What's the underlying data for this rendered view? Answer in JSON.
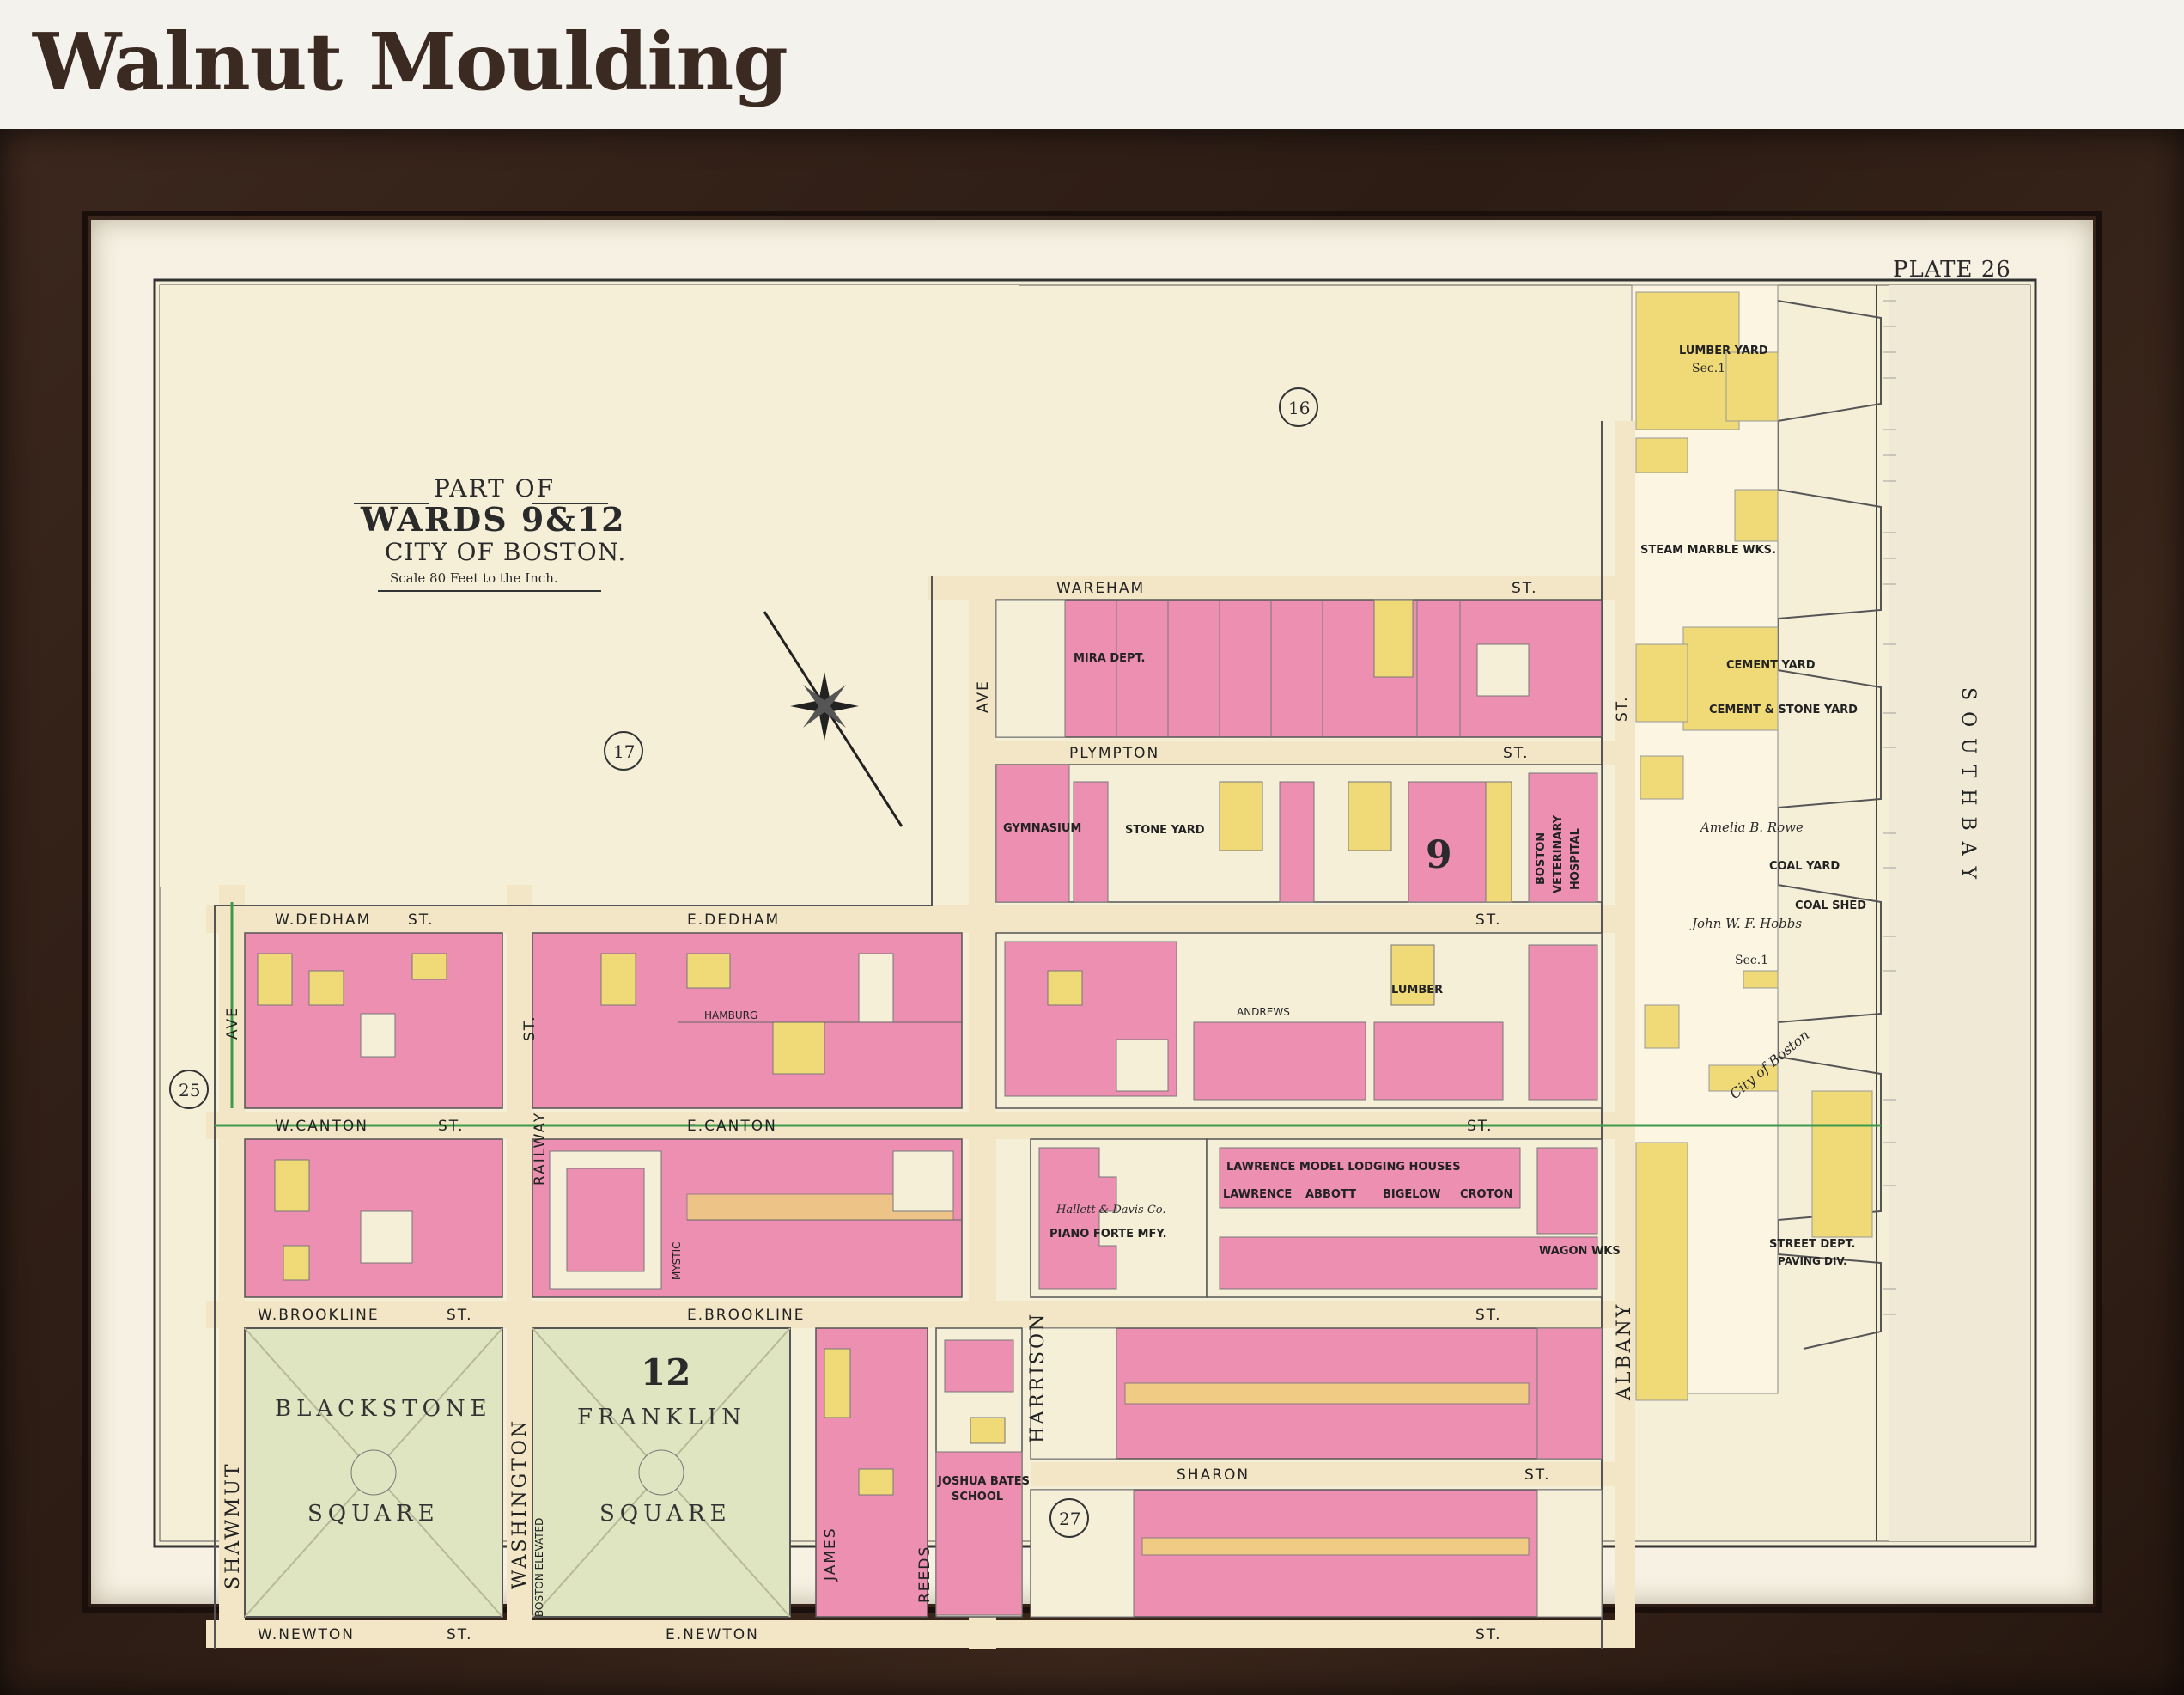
{
  "header": {
    "title": "Walnut Moulding"
  },
  "map": {
    "plate": "PLATE 26",
    "cartouche": {
      "line1": "PART OF",
      "line2": "WARDS 9&12",
      "line3": "CITY OF BOSTON.",
      "scale": "Scale 80 Feet to the Inch."
    },
    "ward_markers": [
      "16",
      "17",
      "25",
      "27"
    ],
    "streets": {
      "wareham": "WAREHAM",
      "plympton": "PLYMPTON",
      "w_dedham": "W.DEDHAM",
      "e_dedham": "E.DEDHAM",
      "w_canton": "W.CANTON",
      "e_canton": "E.CANTON",
      "w_brookline": "W.BROOKLINE",
      "e_brookline": "E.BROOKLINE",
      "w_newton": "W.NEWTON",
      "e_newton": "E.NEWTON",
      "sharon": "SHARON",
      "andrews": "ANDREWS",
      "hamburg": "HAMBURG",
      "st": "ST.",
      "ave": "AVE",
      "shawmut": "SHAWMUT",
      "washington": "WASHINGTON",
      "harrison": "HARRISON",
      "albany": "ALBANY",
      "james": "JAMES",
      "reeds": "REEDS",
      "mystic": "MYSTIC",
      "railway": "RAILWAY",
      "boston_elevated": "BOSTON ELEVATED",
      "south_bay": "S O U T H     B A Y"
    },
    "squares": {
      "blackstone_1": "BLACKSTONE",
      "blackstone_2": "SQUARE",
      "franklin_1": "FRANKLIN",
      "franklin_2": "SQUARE",
      "ward12": "12",
      "ward9": "9"
    },
    "labels": {
      "lawrence": "LAWRENCE MODEL LODGING HOUSES",
      "piano": "PIANO FORTE MFY.",
      "hallet": "Hallett & Davis Co.",
      "joshua": "JOSHUA BATES",
      "school": "SCHOOL",
      "vet1": "BOSTON",
      "vet2": "VETERINARY",
      "vet3": "HOSPITAL",
      "gymnasium": "GYMNASIUM",
      "stone_yard": "STONE YARD",
      "lumber_yard": "LUMBER YARD",
      "cement_yard": "CEMENT YARD",
      "cement_stone": "CEMENT & STONE YARD",
      "coal_yard": "COAL YARD",
      "coal_shed": "COAL SHED",
      "street_dept": "STREET DEPT.",
      "paving": "PAVING DIV.",
      "steam_marble": "STEAM MARBLE WKS.",
      "wagon_wks": "WAGON WKS",
      "mira": "MIRA DEPT.",
      "sec1": "Sec.1",
      "city_of_boston": "City of Boston",
      "amelia": "Amelia B. Rowe",
      "hobbs": "John W. F. Hobbs",
      "lumber": "LUMBER",
      "abbott": "ABBOTT",
      "bigelow": "BIGELOW",
      "croton": "CROTON",
      "lawrence_sm": "LAWRENCE"
    },
    "colors": {
      "brick_pink": "#ec8fb0",
      "wood_yellow": "#f0da78",
      "park_green": "#dfe5c0",
      "paper": "#f6efd8",
      "frame": "#2e1d15"
    }
  }
}
